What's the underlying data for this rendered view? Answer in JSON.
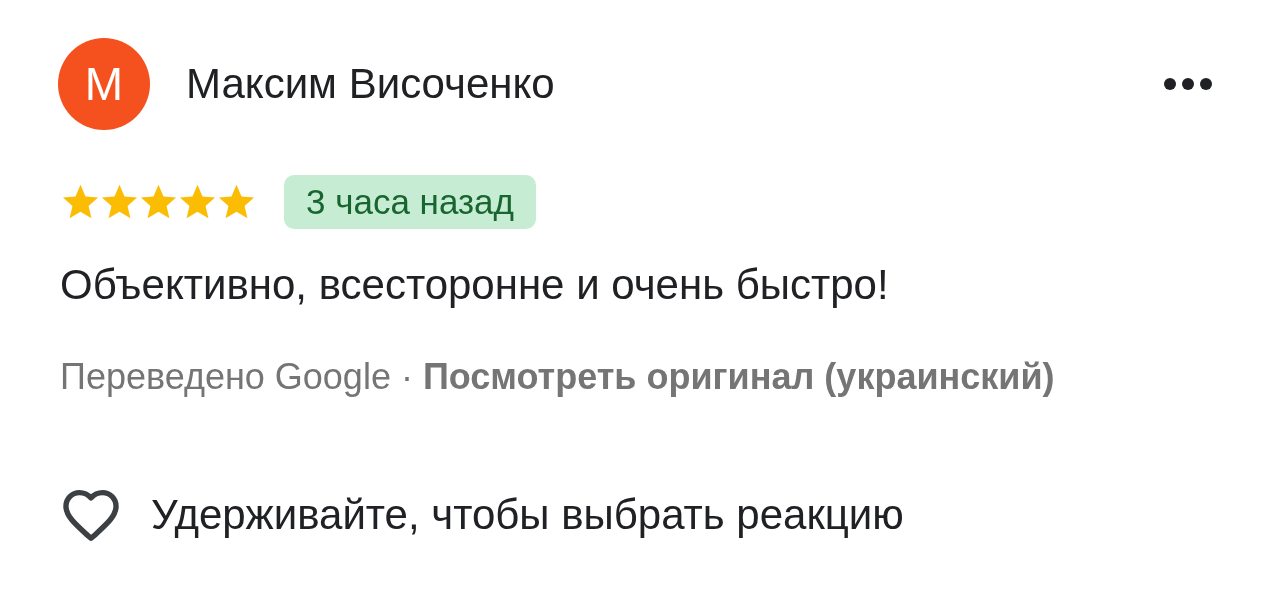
{
  "review": {
    "author": {
      "initial": "М",
      "name": "Максим Височенко"
    },
    "stars": 5,
    "time": "3 часа назад",
    "text": "Объективно, всесторонне и очень быстро!",
    "translation": {
      "label": "Переведено Google ·",
      "link": "Посмотреть оригинал (украинский)"
    },
    "reaction_hint": "Удерживайте, чтобы выбрать реакцию"
  }
}
